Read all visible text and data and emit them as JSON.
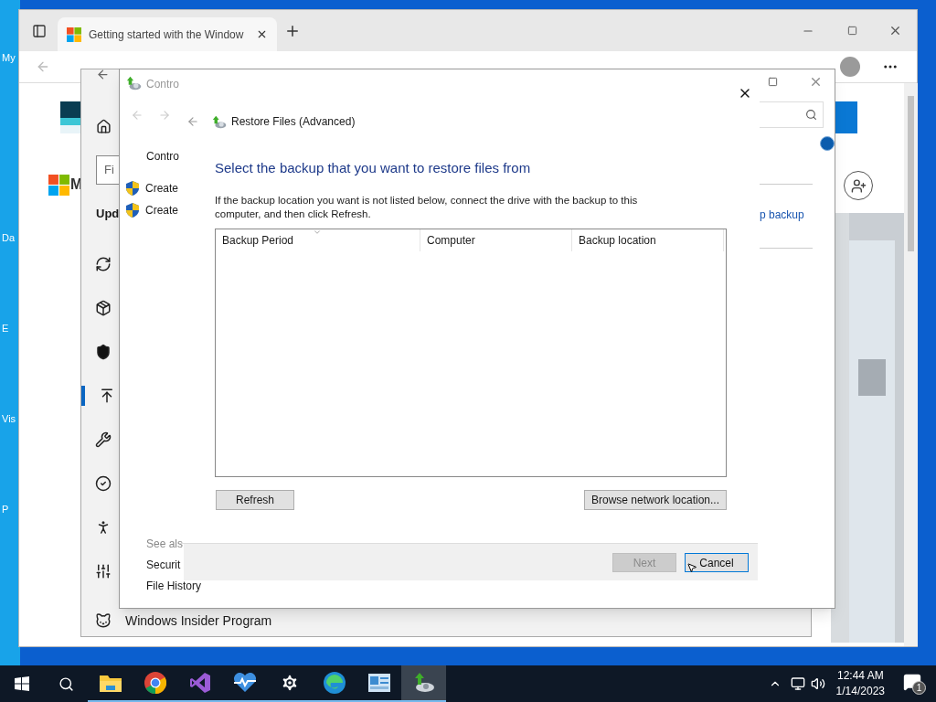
{
  "desktop": {
    "icon_labels": [
      "My",
      "Da",
      "E",
      "Vis",
      "P"
    ]
  },
  "browser": {
    "tab_title": "Getting started with the Window",
    "page_fragment": "M"
  },
  "settings": {
    "search_fragment": "Fi",
    "heading_fragment": "Upd",
    "nav_items": [
      {
        "kind": "sync",
        "selected": false
      },
      {
        "kind": "delivery",
        "selected": false
      },
      {
        "kind": "security",
        "selected": false
      },
      {
        "kind": "backup",
        "selected": true
      },
      {
        "kind": "troubleshoot",
        "selected": false
      },
      {
        "kind": "activation",
        "selected": false
      },
      {
        "kind": "find-device",
        "selected": false
      },
      {
        "kind": "developers",
        "selected": false
      },
      {
        "kind": "insider",
        "selected": false,
        "label": "Windows Insider Program"
      }
    ]
  },
  "control_panel": {
    "title": "Contro",
    "sidebar_heading": "Contro",
    "tasks": [
      "Create",
      "Create"
    ],
    "link": "p backup",
    "see_also_heading": "See als",
    "see_also": [
      "Securit",
      "File History"
    ]
  },
  "dialog": {
    "header": "Restore Files (Advanced)",
    "heading": "Select the backup that you want to restore files from",
    "description": "If the backup location you want is not listed below, connect the drive with the backup to this computer, and then click Refresh.",
    "columns": [
      "Backup Period",
      "Computer",
      "Backup location"
    ],
    "refresh": "Refresh",
    "browse": "Browse network location...",
    "footer_buttons": [
      {
        "label": "Next",
        "disabled": true
      },
      {
        "label": "Cancel",
        "disabled": false
      }
    ]
  },
  "taskbar": {
    "apps": [
      {
        "kind": "explorer",
        "selected": false
      },
      {
        "kind": "chrome",
        "selected": false
      },
      {
        "kind": "visual-studio",
        "selected": false
      },
      {
        "kind": "health",
        "selected": false
      },
      {
        "kind": "settings",
        "selected": false
      },
      {
        "kind": "edge",
        "selected": false
      },
      {
        "kind": "control-panel",
        "selected": false
      },
      {
        "kind": "backup",
        "selected": true
      }
    ],
    "time": "12:44 AM",
    "date": "1/14/2023",
    "notification_count": "1"
  }
}
